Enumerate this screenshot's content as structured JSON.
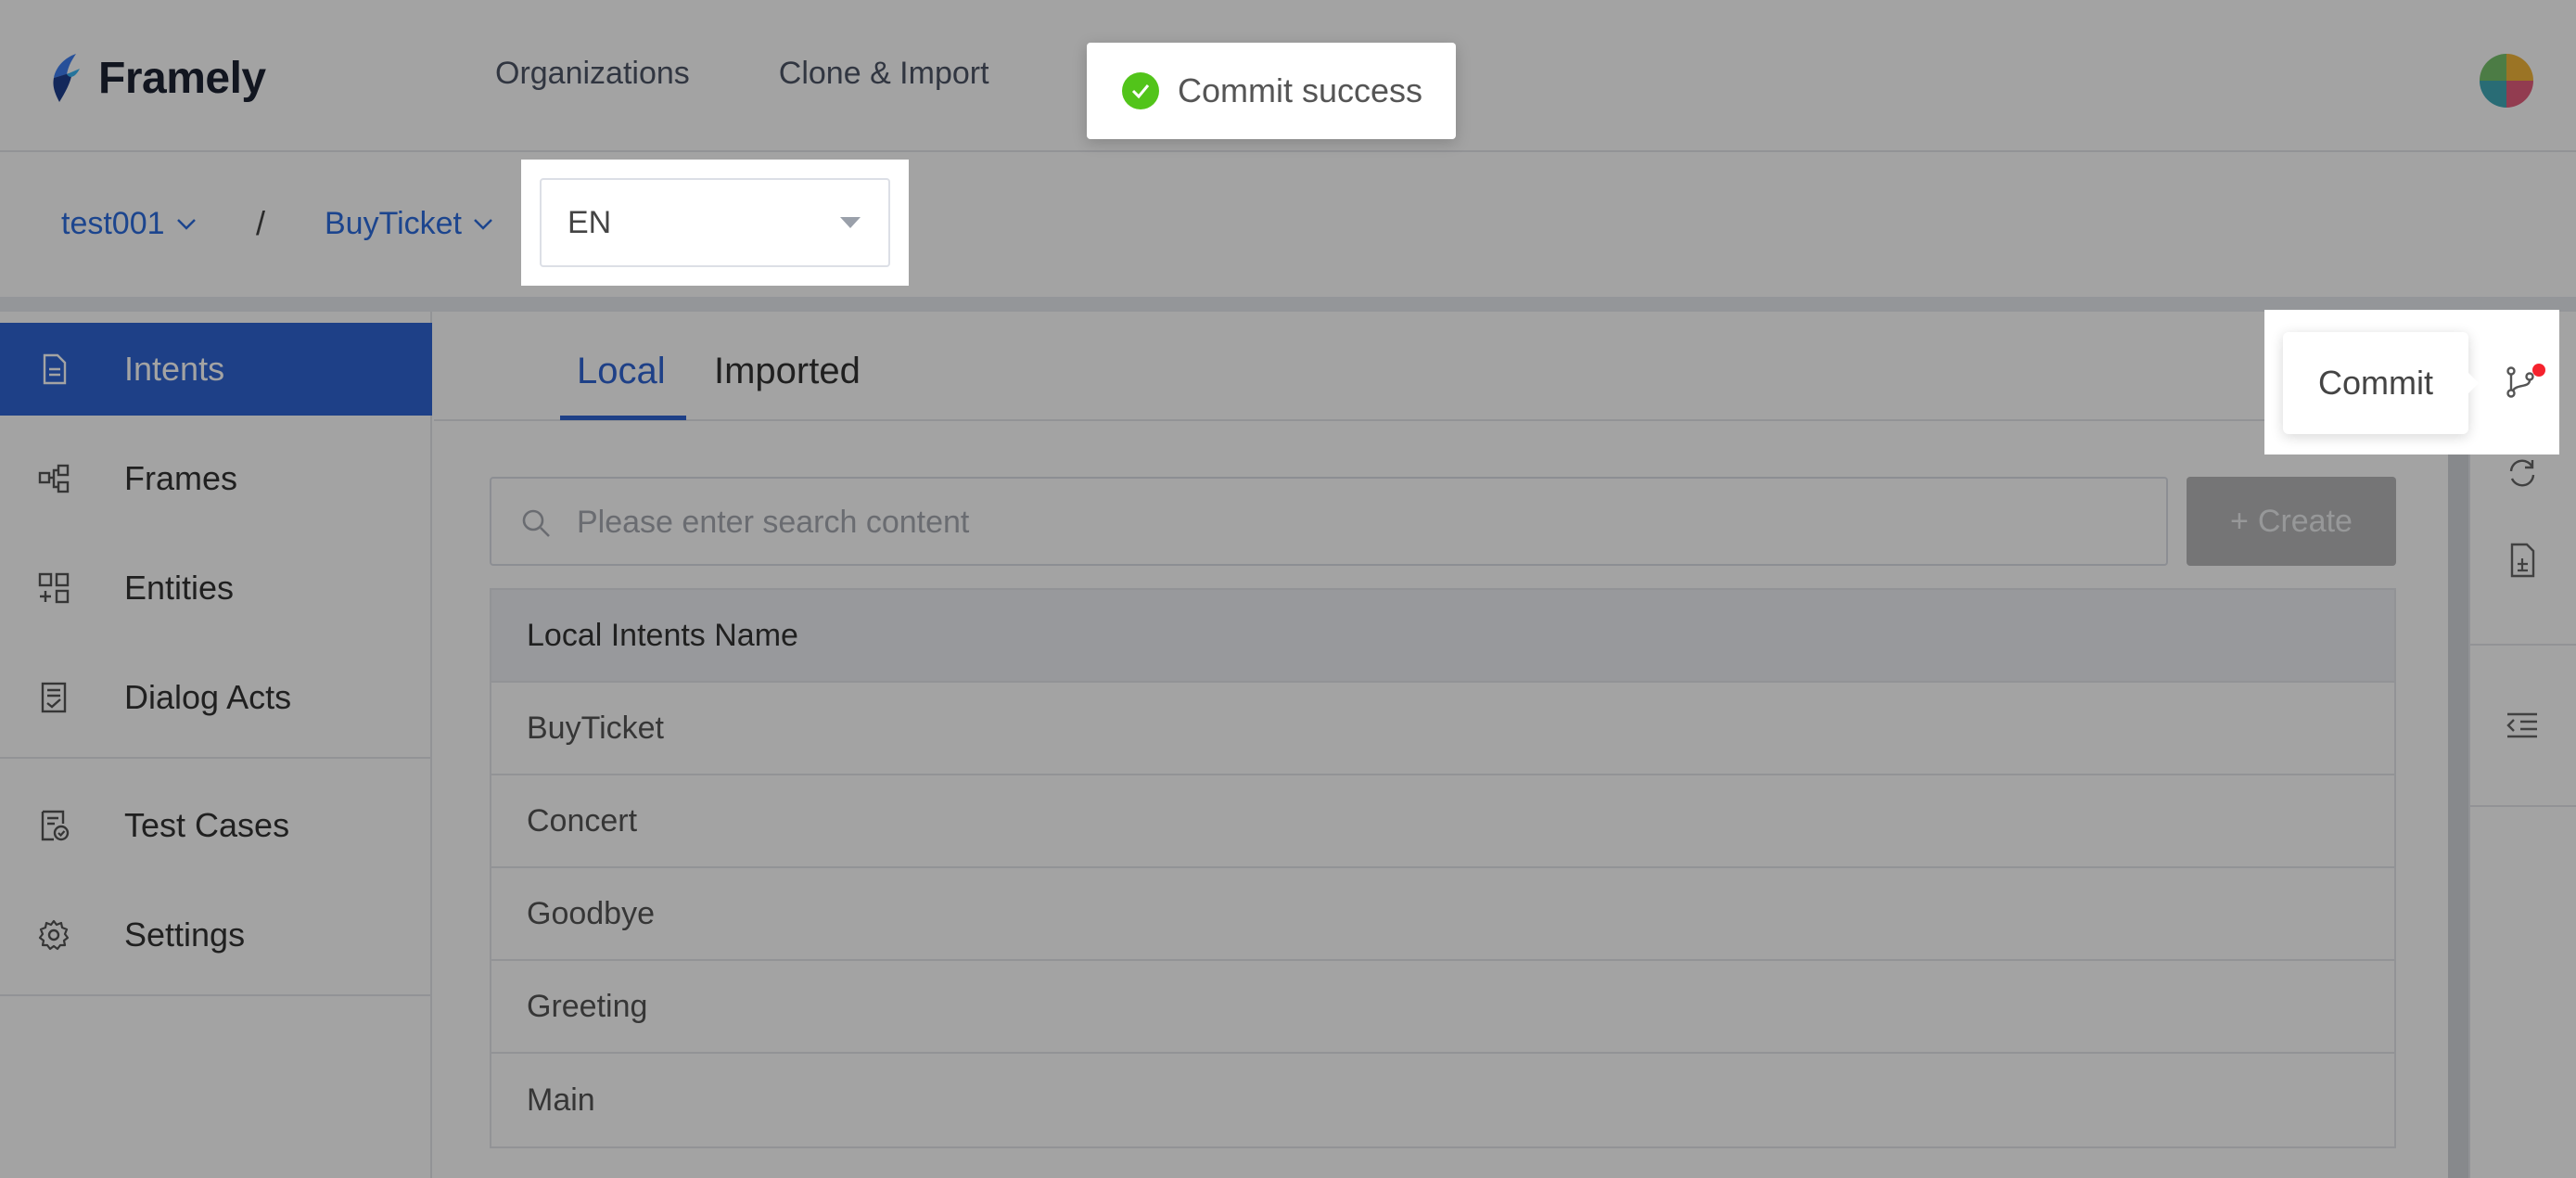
{
  "app": {
    "name": "Framely"
  },
  "header": {
    "nav": [
      {
        "label": "Organizations"
      },
      {
        "label": "Clone & Import"
      }
    ]
  },
  "breadcrumb": {
    "org": "test001",
    "separator": "/",
    "agent": "BuyTicket",
    "language": "EN"
  },
  "sidebar": {
    "items": [
      {
        "label": "Intents",
        "icon": "file-text-icon",
        "active": true
      },
      {
        "label": "Frames",
        "icon": "frames-icon"
      },
      {
        "label": "Entities",
        "icon": "entities-icon"
      },
      {
        "label": "Dialog Acts",
        "icon": "dialog-acts-icon"
      },
      {
        "label": "Test Cases",
        "icon": "test-cases-icon"
      },
      {
        "label": "Settings",
        "icon": "gear-icon"
      }
    ]
  },
  "main": {
    "tabs": [
      {
        "label": "Local",
        "active": true
      },
      {
        "label": "Imported"
      }
    ],
    "search": {
      "placeholder": "Please enter search content",
      "value": ""
    },
    "create_button": {
      "label": "Create"
    },
    "table": {
      "header": "Local Intents Name",
      "rows": [
        "BuyTicket",
        "Concert",
        "Goodbye",
        "Greeting",
        "Main"
      ]
    }
  },
  "right_rail": {
    "buttons": [
      "branch-icon",
      "sync-icon",
      "document-icon",
      "outdent-icon"
    ]
  },
  "tooltip": {
    "label": "Commit"
  },
  "toast": {
    "message": "Commit success",
    "status": "success"
  },
  "colors": {
    "primary": "#2f64d3",
    "success": "#52c41a",
    "badge": "#f5222d"
  }
}
